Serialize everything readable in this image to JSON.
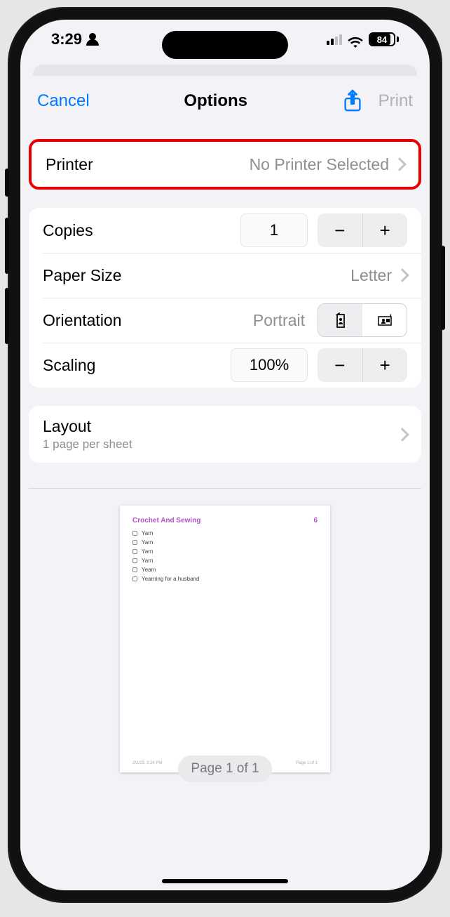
{
  "status": {
    "time": "3:29",
    "battery": "84",
    "cell_bars": 2,
    "wifi_bars": 3
  },
  "header": {
    "cancel": "Cancel",
    "title": "Options",
    "print": "Print"
  },
  "printer": {
    "label": "Printer",
    "value": "No Printer Selected"
  },
  "copies": {
    "label": "Copies",
    "value": "1"
  },
  "paper": {
    "label": "Paper Size",
    "value": "Letter"
  },
  "orientation": {
    "label": "Orientation",
    "value": "Portrait"
  },
  "scaling": {
    "label": "Scaling",
    "value": "100%"
  },
  "layout": {
    "label": "Layout",
    "sub": "1 page per sheet"
  },
  "preview": {
    "doc_title": "Crochet And Sewing",
    "doc_count": "6",
    "items": [
      "Yarn",
      "Yarn",
      "Yarn",
      "Yarn",
      "Yearn",
      "Yearning for a husband"
    ],
    "footer_left": "2/2/23, 3:24 PM",
    "footer_right": "Page 1 of 1",
    "badge": "Page 1 of 1"
  }
}
